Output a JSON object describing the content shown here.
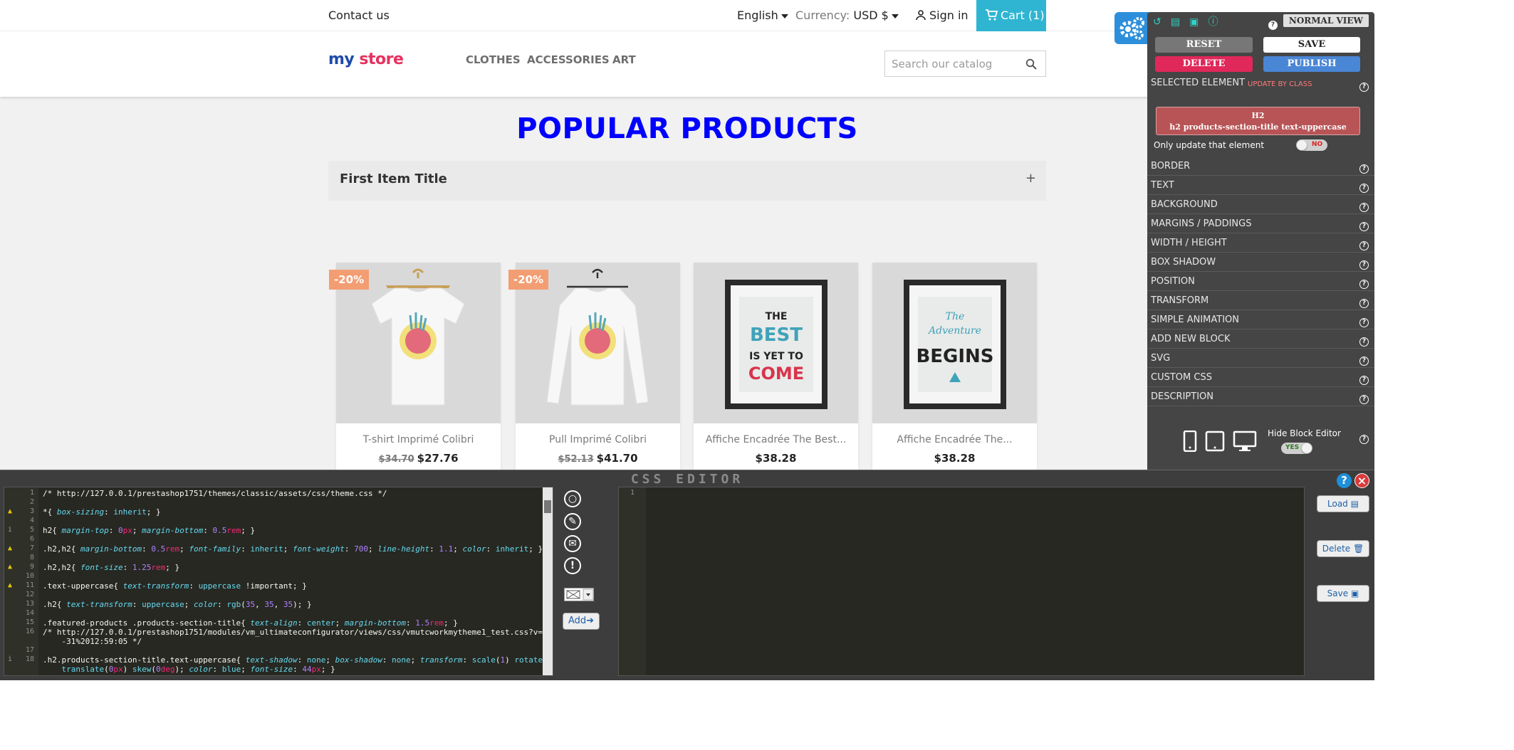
{
  "topbar": {
    "contact": "Contact us",
    "language": "English",
    "currency_label": "Currency:",
    "currency_value": "USD $",
    "signin": "Sign in",
    "cart": "Cart (1)"
  },
  "header": {
    "logo_part1": "my",
    "logo_part2": " store",
    "nav": [
      "CLOTHES",
      "ACCESSORIES",
      "ART"
    ],
    "search_placeholder": "Search our catalog"
  },
  "main": {
    "title": "POPULAR PRODUCTS",
    "accordion_title": "First Item Title",
    "accordion_icon": "+"
  },
  "products": [
    {
      "name": "T-shirt Imprimé Colibri",
      "old_price": "$34.70",
      "price": "$27.76",
      "badge": "-20%"
    },
    {
      "name": "Pull Imprimé Colibri",
      "old_price": "$52.13",
      "price": "$41.70",
      "badge": "-20%"
    },
    {
      "name": "Affiche Encadrée The Best...",
      "old_price": "",
      "price": "$38.28",
      "badge": ""
    },
    {
      "name": "Affiche Encadrée The...",
      "old_price": "",
      "price": "$38.28",
      "badge": ""
    }
  ],
  "panel": {
    "view_button": "NORMAL VIEW",
    "reset": "RESET",
    "save": "SAVE",
    "delete": "DELETE",
    "publish": "PUBLISH",
    "selected_element_label": "SELECTED ELEMENT",
    "update_by_class": "UPDATE BY CLASS",
    "selected_tag": "H2",
    "selected_classes": "h2 products-section-title text-uppercase",
    "only_update_label": "Only update that element",
    "only_update_value": "NO",
    "sections": [
      "BORDER",
      "TEXT",
      "BACKGROUND",
      "MARGINS / PADDINGS",
      "WIDTH / HEIGHT",
      "BOX SHADOW",
      "POSITION",
      "TRANSFORM",
      "SIMPLE ANIMATION",
      "ADD NEW BLOCK",
      "SVG",
      "CUSTOM CSS",
      "DESCRIPTION"
    ],
    "hide_block_editor_label": "Hide Block Editor",
    "hide_block_editor_value": "YES"
  },
  "css_editor": {
    "title": "CSS EDITOR",
    "add_label": "Add",
    "load_label": "Load",
    "delete_label": "Delete",
    "save_label": "Save",
    "right_line_number": "1"
  },
  "colors": {
    "accent": "#2fb5d2",
    "title_blue": "#0000ff",
    "badge": "#f39d72",
    "delete_red": "#e0285a",
    "publish_blue": "#4a86d6",
    "selected_box": "#b85456"
  }
}
